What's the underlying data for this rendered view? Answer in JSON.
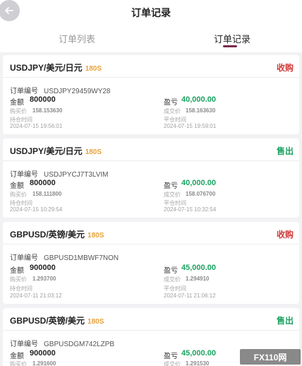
{
  "header": {
    "title": "订单记录"
  },
  "tabs": [
    {
      "label": "订单列表"
    },
    {
      "label": "订单记录"
    }
  ],
  "labels": {
    "order_no": "订单编号",
    "amount": "金额",
    "pnl": "盈亏",
    "buy_price": "购买价",
    "deal_price": "成交价",
    "open_time": "持仓时间",
    "close_time": "平仓时间"
  },
  "orders": [
    {
      "pair": "USDJPY/美元/日元",
      "duration": "180S",
      "direction": "收购",
      "order_no": "USDJPY29459WY28",
      "amount": "800000",
      "pnl": "40,000.00",
      "buy_price": "158.153630",
      "deal_price": "158.163630",
      "open_time": "2024-07-15 19:56:01",
      "close_time": "2024-07-15 19:59:01"
    },
    {
      "pair": "USDJPY/美元/日元",
      "duration": "180S",
      "direction": "售出",
      "order_no": "USDJPYCJ7T3LVIM",
      "amount": "800000",
      "pnl": "40,000.00",
      "buy_price": "158.111800",
      "deal_price": "158.076700",
      "open_time": "2024-07-15 10:29:54",
      "close_time": "2024-07-15 10:32:54"
    },
    {
      "pair": "GBPUSD/英镑/美元",
      "duration": "180S",
      "direction": "收购",
      "order_no": "GBPUSD1MBWF7NON",
      "amount": "900000",
      "pnl": "45,000.00",
      "buy_price": "1.293700",
      "deal_price": "1.294910",
      "open_time": "2024-07-11 21:03:12",
      "close_time": "2024-07-11 21:06:12"
    },
    {
      "pair": "GBPUSD/英镑/美元",
      "duration": "180S",
      "direction": "售出",
      "order_no": "GBPUSDGM742LZPB",
      "amount": "900000",
      "pnl": "45,000.00",
      "buy_price": "1.291600",
      "deal_price": "1.291530",
      "open_time": "",
      "close_time": ""
    }
  ],
  "watermark": "FX110网",
  "colors": {
    "buy": "#d23a3a",
    "sell": "#1aa360",
    "duration": "#e8a23b",
    "profit": "#1aa360"
  }
}
